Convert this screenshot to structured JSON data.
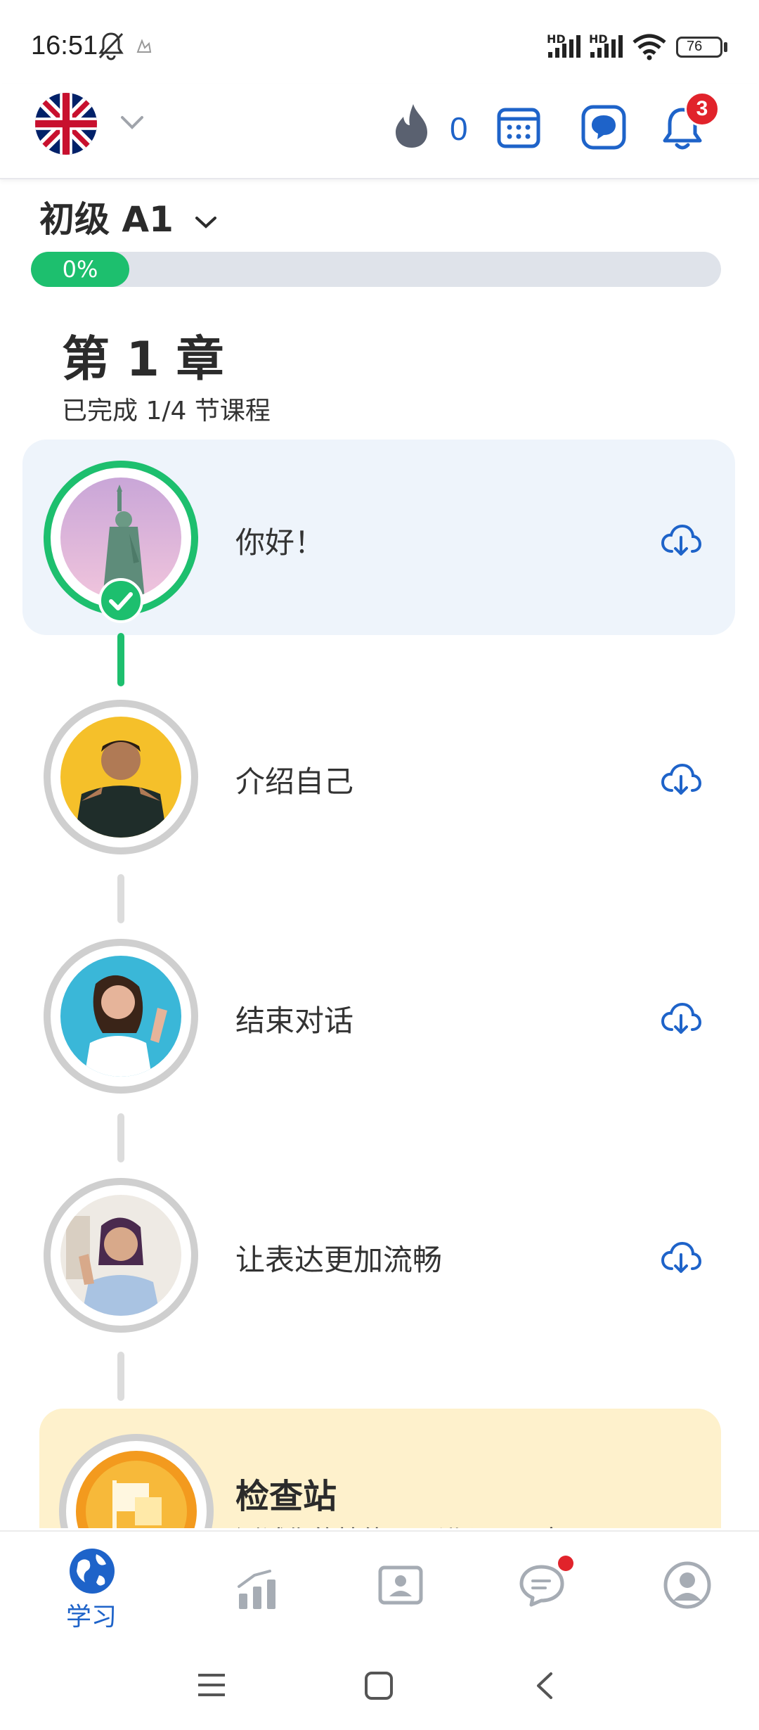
{
  "status_bar": {
    "time": "16:51",
    "battery": "76",
    "network_labels": [
      "HD",
      "HD"
    ]
  },
  "header": {
    "streak_count": "0",
    "notification_count": "3",
    "colors": {
      "accent": "#1e63c9",
      "flame": "#5a6170",
      "badge": "#e1232b"
    }
  },
  "course": {
    "level_title": "初级 A1",
    "progress_text": "0%",
    "progress_value": 0
  },
  "chapter": {
    "title": "第 1 章",
    "subtitle": "已完成 1/4 节课程"
  },
  "lessons": [
    {
      "label": "你好！",
      "status": "completed",
      "image": "statue-of-liberty"
    },
    {
      "label": "介绍自己",
      "status": "locked",
      "image": "man-pointing"
    },
    {
      "label": "结束对话",
      "status": "locked",
      "image": "woman-waving"
    },
    {
      "label": "让表达更加流畅",
      "status": "locked",
      "image": "woman-waving-office"
    }
  ],
  "checkpoint": {
    "title": "检查站",
    "subtitle": "测试你的技能，以进入下一章"
  },
  "bottom_nav": {
    "items": [
      {
        "label": "学习",
        "icon": "globe-icon",
        "active": true
      },
      {
        "label": "",
        "icon": "stats-icon",
        "active": false
      },
      {
        "label": "",
        "icon": "contact-card-icon",
        "active": false
      },
      {
        "label": "",
        "icon": "chat-icon",
        "active": false,
        "has_dot": true
      },
      {
        "label": "",
        "icon": "profile-icon",
        "active": false
      }
    ]
  }
}
